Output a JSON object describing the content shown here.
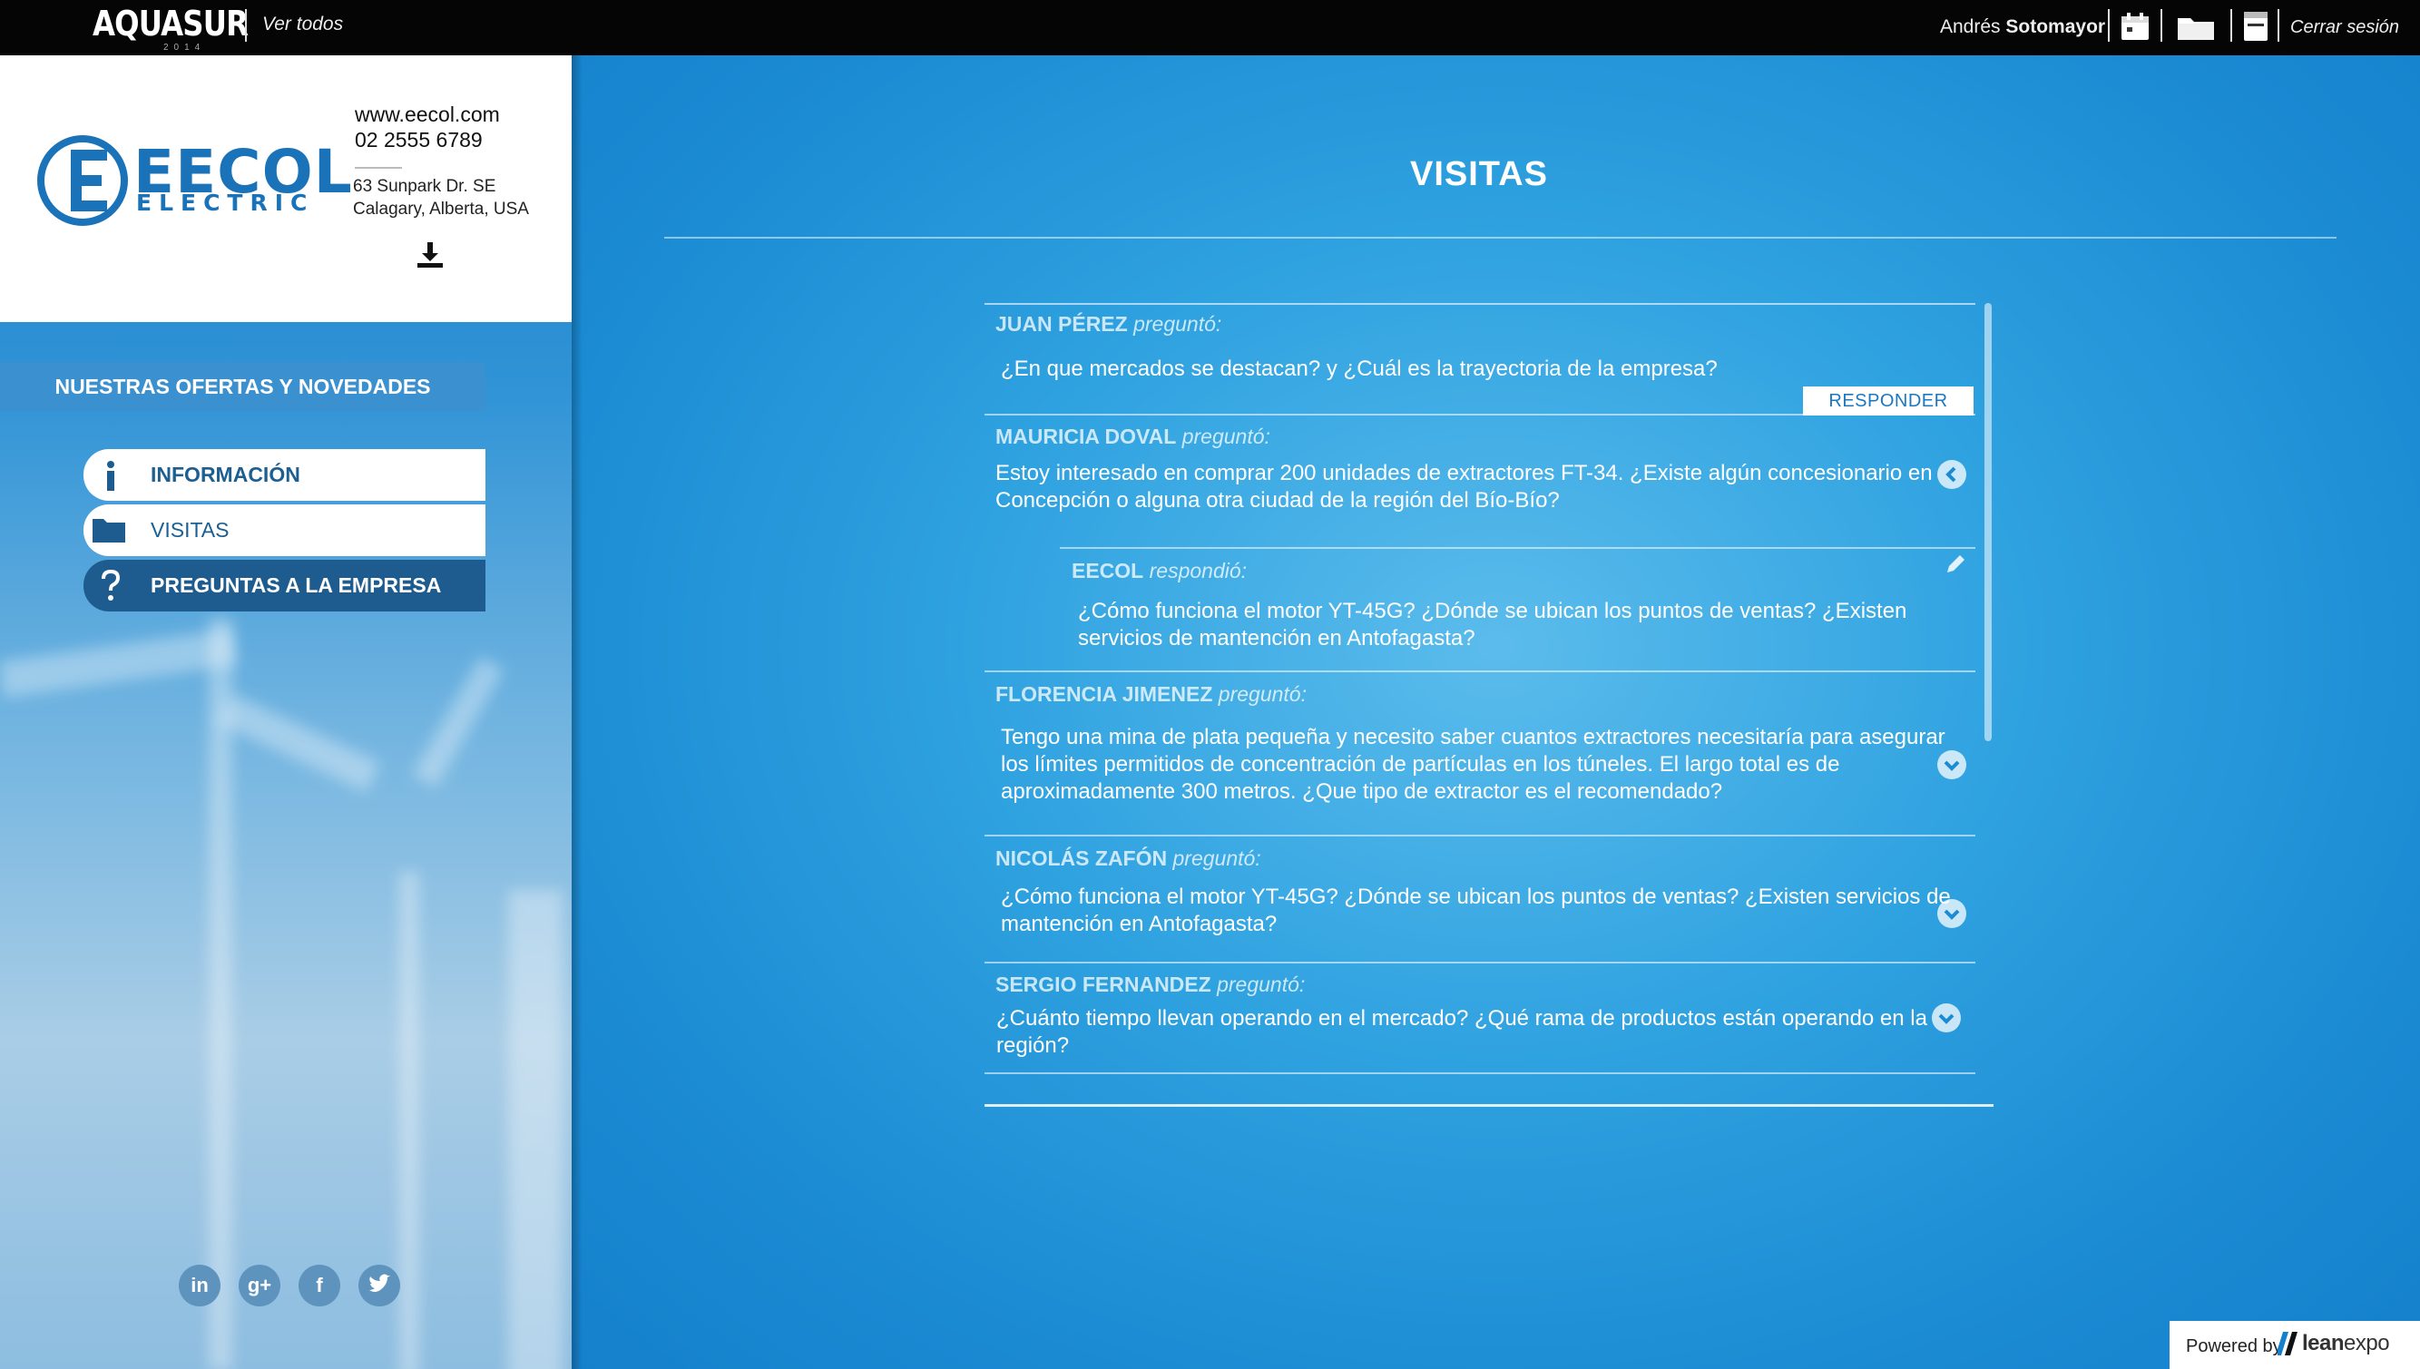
{
  "topbar": {
    "brand": "AQUASUR",
    "brand_sub": "2014",
    "ver_todos": "Ver todos",
    "user_first": "Andrés",
    "user_last": "Sotomayor",
    "logout": "Cerrar sesión"
  },
  "company": {
    "logo_word": "EECOL",
    "logo_sub": "ELECTRIC",
    "web": "www.eecol.com",
    "phone": "02 2555 6789",
    "address_line1": "63 Sunpark Dr. SE",
    "address_line2": "Calagary, Alberta, USA"
  },
  "sidebar": {
    "offers_label": "NUESTRAS OFERTAS Y NOVEDADES",
    "menu": [
      {
        "label": "INFORMACIÓN",
        "icon": "info-icon"
      },
      {
        "label": "VISITAS",
        "icon": "folder-icon"
      },
      {
        "label": "PREGUNTAS A LA EMPRESA",
        "icon": "question-icon"
      }
    ],
    "social": [
      "in",
      "g+",
      "f",
      "twitter"
    ]
  },
  "main": {
    "title": "VISITAS",
    "respond_label": "RESPONDER",
    "asked_suffix": "preguntó:",
    "answered_suffix": "respondió:",
    "questions": [
      {
        "name": "JUAN PÉREZ",
        "text": "¿En que mercados se destacan? y ¿Cuál es la trayectoria de la empresa?"
      },
      {
        "name": "MAURICIA DOVAL",
        "text_line1": "Estoy interesado en comprar 200 unidades de extractores FT-34. ¿Existe algún concesionario en",
        "text_line2": "Concepción o alguna otra ciudad de la región del Bío-Bío?",
        "answer": {
          "name": "EECOL",
          "text_line1": "¿Cómo funciona el motor YT-45G? ¿Dónde se ubican los puntos de ventas? ¿Existen",
          "text_line2": "servicios de mantención en Antofagasta?"
        }
      },
      {
        "name": "FLORENCIA JIMENEZ",
        "text_line1": "Tengo una mina de plata pequeña y necesito saber cuantos extractores necesitaría para asegurar",
        "text_line2": "los límites permitidos de concentración de partículas en los túneles. El largo total es de",
        "text_line3": "aproximadamente 300 metros. ¿Que tipo de extractor es el recomendado?"
      },
      {
        "name": "NICOLÁS ZAFÓN",
        "text_line1": "¿Cómo funciona el motor YT-45G? ¿Dónde se ubican los puntos de ventas? ¿Existen servicios de",
        "text_line2": "mantención en Antofagasta?"
      },
      {
        "name": "SERGIO FERNANDEZ",
        "text_line1": "¿Cuánto tiempo llevan operando en el mercado? ¿Qué rama de productos están operando en la",
        "text_line2": "región?"
      }
    ]
  },
  "footer": {
    "powered_by": "Powered by",
    "vendor_a": "lean",
    "vendor_b": "expo"
  }
}
